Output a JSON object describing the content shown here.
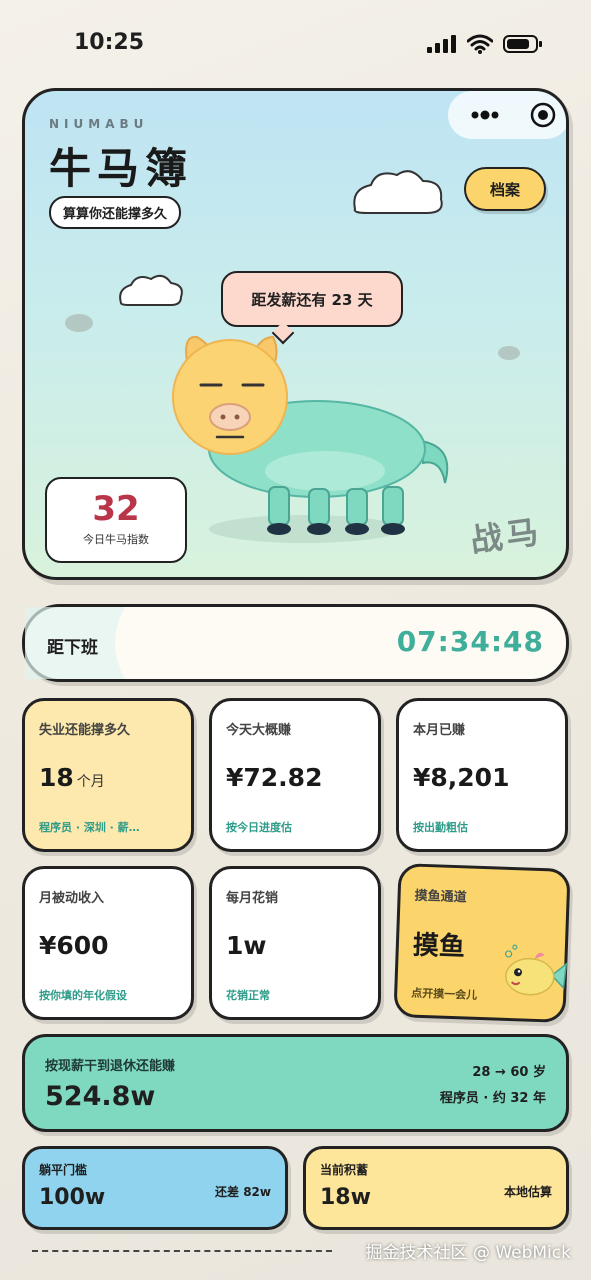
{
  "status": {
    "time": "10:25"
  },
  "hero": {
    "brand": "NIUMABU",
    "title": "牛马簿",
    "tagline": "算算你还能撑多久",
    "archive_button": "档案",
    "payday_bubble": "距发薪还有 23 天",
    "index_value": "32",
    "index_label": "今日牛马指数",
    "horse_label": "战马"
  },
  "offwork": {
    "label": "距下班",
    "time": "07:34:48"
  },
  "cards": [
    {
      "label": "失业还能撑多久",
      "value": "18",
      "unit": "个月",
      "note": "程序员 · 深圳 · 薪…"
    },
    {
      "label": "今天大概赚",
      "value": "¥72.82",
      "note": "按今日进度估"
    },
    {
      "label": "本月已赚",
      "value": "¥8,201",
      "note": "按出勤粗估"
    },
    {
      "label": "月被动收入",
      "value": "¥600",
      "note": "按你填的年化假设"
    },
    {
      "label": "每月花销",
      "value": "1w",
      "note": "花销正常"
    },
    {
      "label": "摸鱼通道",
      "value": "摸鱼",
      "note": "点开摸一会儿"
    }
  ],
  "retire": {
    "label": "按现薪干到退休还能赚",
    "value": "524.8w",
    "age_range": "28 → 60 岁",
    "role": "程序员 · 约 32 年"
  },
  "lie_flat": {
    "label": "躺平门槛",
    "value": "100w",
    "note": "还差 82w"
  },
  "savings": {
    "label": "当前积蓄",
    "value": "18w",
    "note": "本地估算"
  },
  "watermark": "掘金技术社区 @ WebMick",
  "colors": {
    "accent_green": "#3fae9a",
    "yellow": "#fbd56b",
    "mint": "#7fd8c0",
    "sky": "#8fd3ee",
    "red": "#b9354a"
  }
}
